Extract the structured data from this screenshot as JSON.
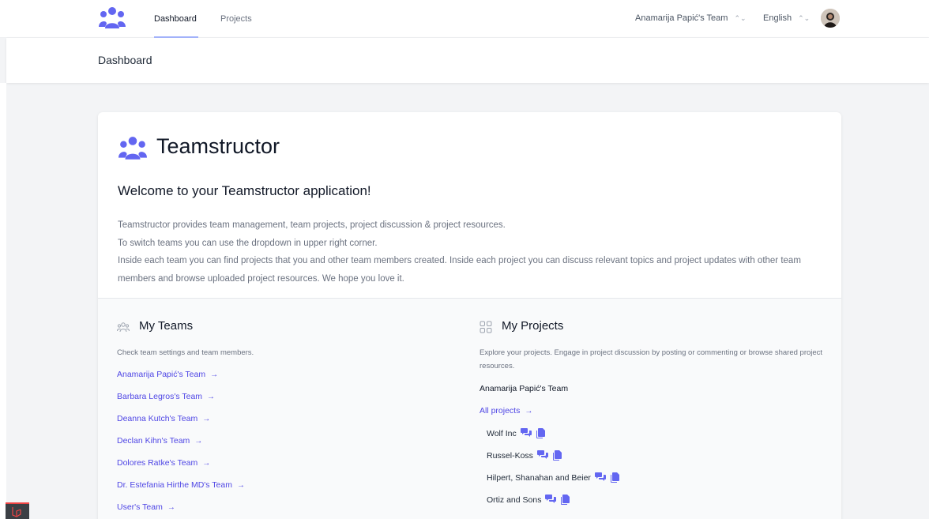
{
  "nav": {
    "links": [
      {
        "label": "Dashboard",
        "active": true
      },
      {
        "label": "Projects",
        "active": false
      }
    ],
    "team_switcher": "Anamarija Papić's Team",
    "language": "English",
    "accent_color": "#6366f1"
  },
  "header": {
    "title": "Dashboard"
  },
  "card": {
    "brand": "Teamstructor",
    "welcome": "Welcome to your Teamstructor application!",
    "intro": [
      "Teamstructor provides team management, team projects, project discussion & project resources.",
      "To switch teams you can use the dropdown in upper right corner.",
      "Inside each team you can find projects that you and other team members created. Inside each project you can discuss relevant topics and project updates with other team members and browse uploaded project resources. We hope you love it."
    ]
  },
  "my_teams": {
    "title": "My Teams",
    "description": "Check team settings and team members.",
    "teams": [
      "Anamarija Papić's Team",
      "Barbara Legros's Team",
      "Deanna Kutch's Team",
      "Declan Kihn's Team",
      "Dolores Ratke's Team",
      "Dr. Estefania Hirthe MD's Team",
      "User's Team"
    ],
    "arrow": "→"
  },
  "my_projects": {
    "title": "My Projects",
    "description": "Explore your projects. Engage in project discussion by posting or commenting or browse shared project resources.",
    "team_name": "Anamarija Papić's Team",
    "all_projects_label": "All projects",
    "projects": [
      "Wolf Inc",
      "Russel-Koss",
      "Hilpert, Shanahan and Beier",
      "Ortiz and Sons"
    ]
  },
  "icons": {
    "logo": "users-group-icon",
    "teams": "users-outline-icon",
    "projects": "grid-outline-icon",
    "discussion": "chat-bubbles-icon",
    "resources": "documents-icon",
    "chevron": "selector-chevron-icon"
  }
}
